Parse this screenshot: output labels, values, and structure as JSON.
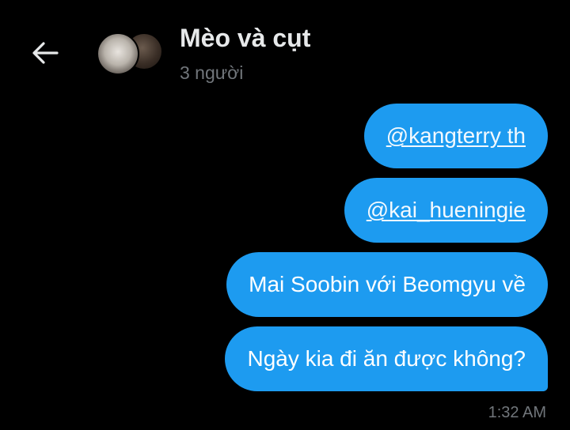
{
  "header": {
    "back_icon": "arrow-left-icon",
    "title": "Mèo và cụt",
    "subtitle": "3 người"
  },
  "messages": [
    {
      "text": "@kangterry th",
      "type": "mention"
    },
    {
      "text": "@kai_hueningie",
      "type": "mention"
    },
    {
      "text": "Mai Soobin với Beomgyu về",
      "type": "text"
    },
    {
      "text": "Ngày kia đi ăn được không?",
      "type": "text"
    }
  ],
  "timestamp": "1:32 AM",
  "colors": {
    "background": "#000000",
    "bubble": "#1d9bf0",
    "muted": "#71767b",
    "text": "#e7e9ea"
  }
}
